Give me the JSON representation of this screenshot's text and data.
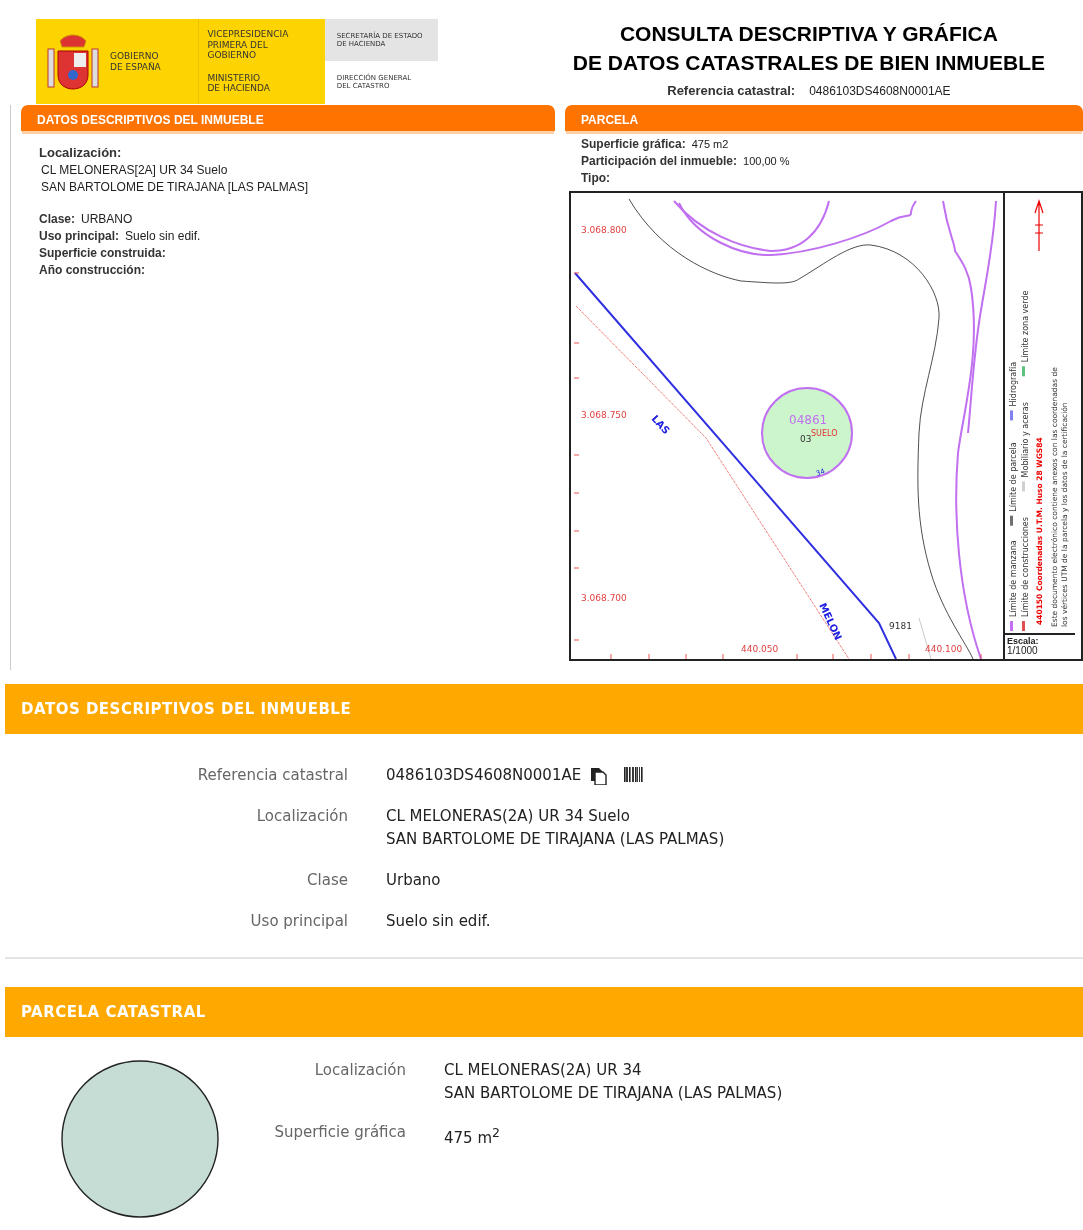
{
  "header": {
    "logo": {
      "government": "GOBIERNO\nDE ESPAÑA",
      "vicepresidency": "VICEPRESIDENCIA\nPRIMERA DEL GOBIERNO",
      "ministry": "MINISTERIO\nDE HACIENDA",
      "secretariat": "SECRETARÍA DE ESTADO\nDE HACIENDA",
      "directorate": "DIRECCIÓN GENERAL\nDEL CATASTRO"
    },
    "title": "CONSULTA DESCRIPTIVA Y GRÁFICA\nDE DATOS CATASTRALES DE BIEN INMUEBLE",
    "reference": {
      "label": "Referencia catastral:",
      "value": "0486103DS4608N0001AE"
    }
  },
  "descriptive_panel": {
    "title": "DATOS DESCRIPTIVOS DEL INMUEBLE",
    "location_label": "Localización:",
    "location_lines": [
      "CL MELONERAS[2A] UR 34 Suelo",
      "SAN BARTOLOME DE TIRAJANA [LAS PALMAS]"
    ],
    "fields": [
      {
        "label": "Clase:",
        "value": "URBANO"
      },
      {
        "label": "Uso principal:",
        "value": "Suelo sin edif."
      },
      {
        "label": "Superficie construida:"
      },
      {
        "label": "Año construcción:"
      }
    ]
  },
  "parcel_panel": {
    "title": "PARCELA",
    "fields": [
      {
        "label": "Superficie gráfica:",
        "value": "475 m2"
      },
      {
        "label": "Participación del inmueble:",
        "value": "100,00 %"
      },
      {
        "label": "Tipo:"
      }
    ],
    "map": {
      "y_ticks": [
        "3.068.800",
        "3.068.750",
        "3.068.700"
      ],
      "x_ticks": [
        "440.050",
        "440.100"
      ],
      "streets": [
        "LAS",
        "MELON"
      ],
      "parcel": {
        "number": "04861",
        "sub": "03",
        "use": "SUELO",
        "street_number": "34"
      },
      "other_parcel": "9181",
      "legend": [
        {
          "label": "Límite de manzana",
          "color": "#c070f0"
        },
        {
          "label": "Límite de construcciones",
          "color": "#e05050"
        },
        {
          "label": "Límite de parcela",
          "color": "#707070"
        },
        {
          "label": "Mobiliario y aceras",
          "color": "#d0d0d0"
        },
        {
          "label": "Hidrografía",
          "color": "#8080f0"
        },
        {
          "label": "Límite zona verde",
          "color": "#60c080"
        }
      ],
      "utm_note": "440150 Coordenadas U.T.M. Huso 28 WGS84",
      "certification_note": "Este documento electrónico contiene anexos con las coordenadas de los vértices UTM de la parcela y los datos de la certificación",
      "scale_label": "Escala:",
      "scale_value": "1/1000"
    }
  },
  "property_section": {
    "title": "DATOS DESCRIPTIVOS DEL INMUEBLE",
    "rows": [
      {
        "label": "Referencia catastral",
        "lines": [
          "0486103DS4608N0001AE"
        ],
        "kind": "reference"
      },
      {
        "label": "Localización",
        "lines": [
          "CL MELONERAS(2A) UR 34 Suelo",
          "SAN BARTOLOME DE TIRAJANA (LAS PALMAS)"
        ],
        "kind": "text"
      },
      {
        "label": "Clase",
        "lines": [
          "Urbano"
        ],
        "kind": "text"
      },
      {
        "label": "Uso principal",
        "lines": [
          "Suelo sin edif."
        ],
        "kind": "text"
      }
    ]
  },
  "parcel_section": {
    "title": "PARCELA CATASTRAL",
    "rows": [
      {
        "label": "Localización",
        "lines": [
          "CL MELONERAS(2A) UR 34",
          "SAN BARTOLOME DE TIRAJANA (LAS PALMAS)"
        ]
      },
      {
        "label": "Superficie gráfica",
        "lines": [
          "475 m$^{2}$"
        ]
      }
    ]
  }
}
